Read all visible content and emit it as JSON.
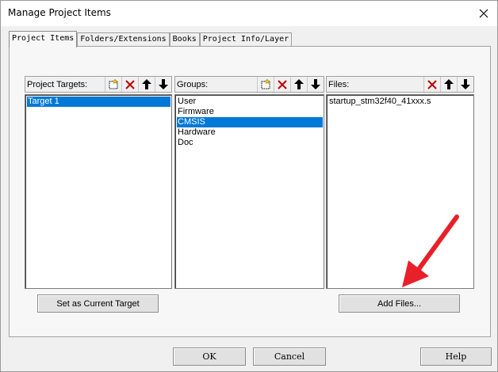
{
  "window": {
    "title": "Manage Project Items"
  },
  "tabs": [
    {
      "label": "Project Items"
    },
    {
      "label": "Folders/Extensions"
    },
    {
      "label": "Books"
    },
    {
      "label": "Project Info/Layer"
    }
  ],
  "targets": {
    "label": "Project Targets:",
    "items": [
      "Target 1"
    ],
    "selected": "Target 1"
  },
  "groups": {
    "label": "Groups:",
    "items": [
      "User",
      "Firmware",
      "CMSIS",
      "Hardware",
      "Doc"
    ],
    "selected": "CMSIS"
  },
  "files": {
    "label": "Files:",
    "items": [
      "startup_stm32f40_41xxx.s"
    ]
  },
  "buttons": {
    "set_current_target": "Set as Current Target",
    "add_files": "Add Files...",
    "ok": "OK",
    "cancel": "Cancel",
    "help": "Help"
  },
  "colors": {
    "selection": "#0078d7",
    "annotation_arrow": "#e8202a"
  }
}
